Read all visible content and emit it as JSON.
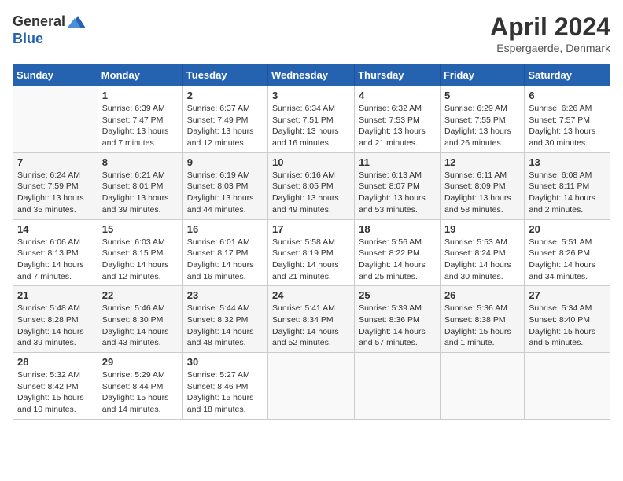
{
  "header": {
    "logo_general": "General",
    "logo_blue": "Blue",
    "month_title": "April 2024",
    "location": "Espergaerde, Denmark"
  },
  "weekdays": [
    "Sunday",
    "Monday",
    "Tuesday",
    "Wednesday",
    "Thursday",
    "Friday",
    "Saturday"
  ],
  "weeks": [
    [
      {
        "day": "",
        "sunrise": "",
        "sunset": "",
        "daylight": ""
      },
      {
        "day": "1",
        "sunrise": "Sunrise: 6:39 AM",
        "sunset": "Sunset: 7:47 PM",
        "daylight": "Daylight: 13 hours and 7 minutes."
      },
      {
        "day": "2",
        "sunrise": "Sunrise: 6:37 AM",
        "sunset": "Sunset: 7:49 PM",
        "daylight": "Daylight: 13 hours and 12 minutes."
      },
      {
        "day": "3",
        "sunrise": "Sunrise: 6:34 AM",
        "sunset": "Sunset: 7:51 PM",
        "daylight": "Daylight: 13 hours and 16 minutes."
      },
      {
        "day": "4",
        "sunrise": "Sunrise: 6:32 AM",
        "sunset": "Sunset: 7:53 PM",
        "daylight": "Daylight: 13 hours and 21 minutes."
      },
      {
        "day": "5",
        "sunrise": "Sunrise: 6:29 AM",
        "sunset": "Sunset: 7:55 PM",
        "daylight": "Daylight: 13 hours and 26 minutes."
      },
      {
        "day": "6",
        "sunrise": "Sunrise: 6:26 AM",
        "sunset": "Sunset: 7:57 PM",
        "daylight": "Daylight: 13 hours and 30 minutes."
      }
    ],
    [
      {
        "day": "7",
        "sunrise": "Sunrise: 6:24 AM",
        "sunset": "Sunset: 7:59 PM",
        "daylight": "Daylight: 13 hours and 35 minutes."
      },
      {
        "day": "8",
        "sunrise": "Sunrise: 6:21 AM",
        "sunset": "Sunset: 8:01 PM",
        "daylight": "Daylight: 13 hours and 39 minutes."
      },
      {
        "day": "9",
        "sunrise": "Sunrise: 6:19 AM",
        "sunset": "Sunset: 8:03 PM",
        "daylight": "Daylight: 13 hours and 44 minutes."
      },
      {
        "day": "10",
        "sunrise": "Sunrise: 6:16 AM",
        "sunset": "Sunset: 8:05 PM",
        "daylight": "Daylight: 13 hours and 49 minutes."
      },
      {
        "day": "11",
        "sunrise": "Sunrise: 6:13 AM",
        "sunset": "Sunset: 8:07 PM",
        "daylight": "Daylight: 13 hours and 53 minutes."
      },
      {
        "day": "12",
        "sunrise": "Sunrise: 6:11 AM",
        "sunset": "Sunset: 8:09 PM",
        "daylight": "Daylight: 13 hours and 58 minutes."
      },
      {
        "day": "13",
        "sunrise": "Sunrise: 6:08 AM",
        "sunset": "Sunset: 8:11 PM",
        "daylight": "Daylight: 14 hours and 2 minutes."
      }
    ],
    [
      {
        "day": "14",
        "sunrise": "Sunrise: 6:06 AM",
        "sunset": "Sunset: 8:13 PM",
        "daylight": "Daylight: 14 hours and 7 minutes."
      },
      {
        "day": "15",
        "sunrise": "Sunrise: 6:03 AM",
        "sunset": "Sunset: 8:15 PM",
        "daylight": "Daylight: 14 hours and 12 minutes."
      },
      {
        "day": "16",
        "sunrise": "Sunrise: 6:01 AM",
        "sunset": "Sunset: 8:17 PM",
        "daylight": "Daylight: 14 hours and 16 minutes."
      },
      {
        "day": "17",
        "sunrise": "Sunrise: 5:58 AM",
        "sunset": "Sunset: 8:19 PM",
        "daylight": "Daylight: 14 hours and 21 minutes."
      },
      {
        "day": "18",
        "sunrise": "Sunrise: 5:56 AM",
        "sunset": "Sunset: 8:22 PM",
        "daylight": "Daylight: 14 hours and 25 minutes."
      },
      {
        "day": "19",
        "sunrise": "Sunrise: 5:53 AM",
        "sunset": "Sunset: 8:24 PM",
        "daylight": "Daylight: 14 hours and 30 minutes."
      },
      {
        "day": "20",
        "sunrise": "Sunrise: 5:51 AM",
        "sunset": "Sunset: 8:26 PM",
        "daylight": "Daylight: 14 hours and 34 minutes."
      }
    ],
    [
      {
        "day": "21",
        "sunrise": "Sunrise: 5:48 AM",
        "sunset": "Sunset: 8:28 PM",
        "daylight": "Daylight: 14 hours and 39 minutes."
      },
      {
        "day": "22",
        "sunrise": "Sunrise: 5:46 AM",
        "sunset": "Sunset: 8:30 PM",
        "daylight": "Daylight: 14 hours and 43 minutes."
      },
      {
        "day": "23",
        "sunrise": "Sunrise: 5:44 AM",
        "sunset": "Sunset: 8:32 PM",
        "daylight": "Daylight: 14 hours and 48 minutes."
      },
      {
        "day": "24",
        "sunrise": "Sunrise: 5:41 AM",
        "sunset": "Sunset: 8:34 PM",
        "daylight": "Daylight: 14 hours and 52 minutes."
      },
      {
        "day": "25",
        "sunrise": "Sunrise: 5:39 AM",
        "sunset": "Sunset: 8:36 PM",
        "daylight": "Daylight: 14 hours and 57 minutes."
      },
      {
        "day": "26",
        "sunrise": "Sunrise: 5:36 AM",
        "sunset": "Sunset: 8:38 PM",
        "daylight": "Daylight: 15 hours and 1 minute."
      },
      {
        "day": "27",
        "sunrise": "Sunrise: 5:34 AM",
        "sunset": "Sunset: 8:40 PM",
        "daylight": "Daylight: 15 hours and 5 minutes."
      }
    ],
    [
      {
        "day": "28",
        "sunrise": "Sunrise: 5:32 AM",
        "sunset": "Sunset: 8:42 PM",
        "daylight": "Daylight: 15 hours and 10 minutes."
      },
      {
        "day": "29",
        "sunrise": "Sunrise: 5:29 AM",
        "sunset": "Sunset: 8:44 PM",
        "daylight": "Daylight: 15 hours and 14 minutes."
      },
      {
        "day": "30",
        "sunrise": "Sunrise: 5:27 AM",
        "sunset": "Sunset: 8:46 PM",
        "daylight": "Daylight: 15 hours and 18 minutes."
      },
      {
        "day": "",
        "sunrise": "",
        "sunset": "",
        "daylight": ""
      },
      {
        "day": "",
        "sunrise": "",
        "sunset": "",
        "daylight": ""
      },
      {
        "day": "",
        "sunrise": "",
        "sunset": "",
        "daylight": ""
      },
      {
        "day": "",
        "sunrise": "",
        "sunset": "",
        "daylight": ""
      }
    ]
  ]
}
